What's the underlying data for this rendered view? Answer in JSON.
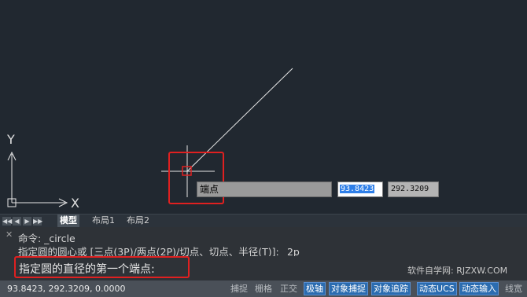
{
  "canvas": {
    "dynamic_input": {
      "label": "端点",
      "x_value": "93.8423",
      "y_value": "292.3209"
    },
    "ucs": {
      "x_label": "X",
      "y_label": "Y"
    }
  },
  "layout_tabs": {
    "nav_buttons": [
      "◀◀",
      "◀",
      "▶",
      "▶▶"
    ],
    "tabs": [
      "模型",
      "布局1",
      "布局2"
    ]
  },
  "command_line": {
    "close": "✕",
    "history": [
      "命令: _circle",
      "指定圆的圆心或 [三点(3P)/两点(2P)/切点、切点、半径(T)]: _2p"
    ],
    "prompt": "指定圆的直径的第一个端点:",
    "watermark": "软件自学网: RJZXW.COM"
  },
  "status_bar": {
    "coordinates": "93.8423, 292.3209, 0.0000",
    "buttons": [
      {
        "label": "捕捉",
        "on": false
      },
      {
        "label": "栅格",
        "on": false
      },
      {
        "label": "正交",
        "on": false
      },
      {
        "label": "极轴",
        "on": true
      },
      {
        "label": "对象捕捉",
        "on": true
      },
      {
        "label": "对象追踪",
        "on": true
      },
      {
        "label": "动态UCS",
        "on": true
      },
      {
        "label": "动态输入",
        "on": true
      },
      {
        "label": "线宽",
        "on": false
      }
    ]
  },
  "colors": {
    "canvas_bg": "#212830",
    "highlight_red": "#e02020",
    "status_on": "#2b6cb0"
  }
}
